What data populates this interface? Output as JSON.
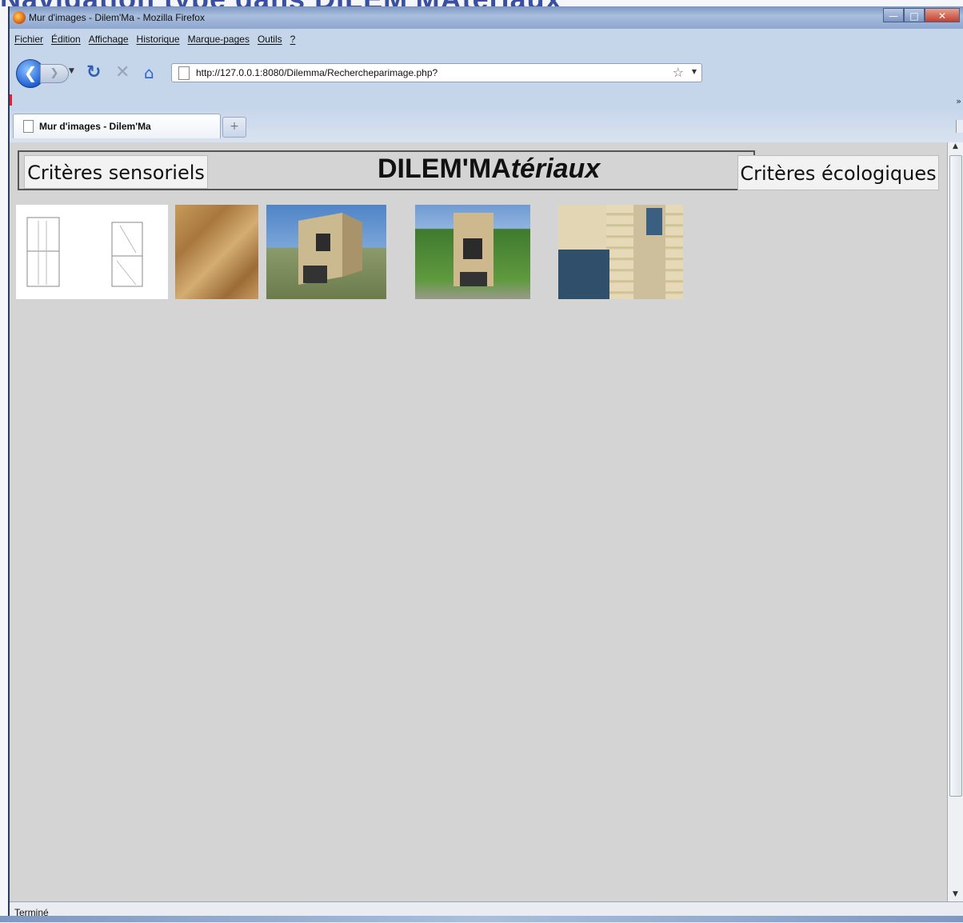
{
  "slide": {
    "title": "Navigation type dans DILEM'MAtériaux"
  },
  "window": {
    "title": "Mur d'images - Dilem'Ma - Mozilla Firefox"
  },
  "menu": [
    "Fichier",
    "Édition",
    "Affichage",
    "Historique",
    "Marque-pages",
    "Outils",
    "?"
  ],
  "nav": {
    "url": "http://127.0.0.1:8080/Dilemma/Rechercheparimage.php?"
  },
  "tabs": [
    {
      "label": "Mur d'images - Dilem'Ma",
      "active": true
    }
  ],
  "page": {
    "btn_sensoriels": "Critères sensoriels",
    "title_main": "DILEM'MA",
    "title_italic": "tériaux",
    "btn_ecologiques": "Critères écologiques",
    "images": [
      {
        "icon": "drawing-image"
      },
      {
        "icon": "stone-texture-image"
      },
      {
        "icon": "house-photo-image"
      },
      {
        "icon": "house-front-photo-image"
      },
      {
        "icon": "wood-facade-image"
      }
    ]
  },
  "status": {
    "text": "Terminé"
  },
  "colors": {
    "content_bg": "#d4d4d4",
    "chrome_bg": "#c5d5ea",
    "accent": "#1f5fd3"
  }
}
